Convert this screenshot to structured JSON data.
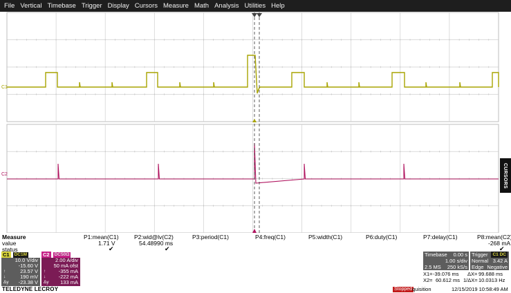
{
  "menu": [
    "File",
    "Vertical",
    "Timebase",
    "Trigger",
    "Display",
    "Cursors",
    "Measure",
    "Math",
    "Analysis",
    "Utilities",
    "Help"
  ],
  "traces": {
    "c1_label": "C1",
    "c2_label": "C2",
    "c1_color": "#a8a400",
    "c2_color": "#b0145f"
  },
  "cursors_tab": "CURSORS",
  "measure": {
    "row_labels": [
      "Measure",
      "value",
      "status"
    ],
    "params": [
      {
        "name": "P1:mean(C1)",
        "value": "1.71 V",
        "status": "✔"
      },
      {
        "name": "P2:wid@lv(C2)",
        "value": "54.48990 ms",
        "status": "✔"
      },
      {
        "name": "P3:period(C1)",
        "value": "",
        "status": ""
      },
      {
        "name": "P4:freq(C1)",
        "value": "",
        "status": ""
      },
      {
        "name": "P5:width(C1)",
        "value": "",
        "status": ""
      },
      {
        "name": "P6:duty(C1)",
        "value": "",
        "status": ""
      },
      {
        "name": "P7:delay(C1)",
        "value": "",
        "status": ""
      },
      {
        "name": "P8:mean(C2)",
        "value": "-268 mA",
        "status": "✔"
      }
    ]
  },
  "channel1": {
    "tag": "C1",
    "badge": "DC1M",
    "rows": [
      "10.0 V/div",
      "-15.60 V",
      "23.57 V",
      "190 mV",
      "-23.38 V"
    ],
    "syms": [
      "",
      "",
      "↑",
      "↓",
      "Δy"
    ]
  },
  "channel2": {
    "tag": "C2",
    "badge": "DC50Ω",
    "rows": [
      "2.00 A/div",
      "50 mA ofst",
      "-355 mA",
      "-222 mA",
      "133 mA"
    ],
    "syms": [
      "",
      "",
      "↑",
      "↓",
      "Δy"
    ]
  },
  "timebase": {
    "label": "Timebase",
    "delay": "0.00 s",
    "per_div": "1.00 s/div",
    "samples": "2.5 MS",
    "rate": "250 kS/s"
  },
  "trigger": {
    "label": "Trigger",
    "badge": "C1 DC",
    "mode": "Normal",
    "level": "3.42 A",
    "type": "Edge",
    "slope": "Negative"
  },
  "cursor_readout": {
    "x1_label": "X1=",
    "x1": "-39.076 ms",
    "dx_label": "ΔX=",
    "dx": "99.688 ms",
    "x2_label": "X2=",
    "x2": "60.612 ms",
    "inv_dx_label": "1/ΔX=",
    "inv_dx": "10.0313 Hz"
  },
  "footer": {
    "brand": "TELEDYNE LECROY",
    "acq_badge": "Stopped",
    "acq_text": "quisition",
    "datetime": "12/15/2019 10:58:49 AM"
  }
}
